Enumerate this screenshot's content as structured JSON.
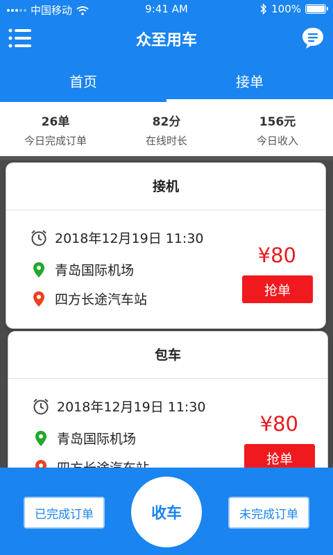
{
  "status_bar": {
    "carrier": "中国移动",
    "time": "9:41 AM",
    "battery": "100%"
  },
  "titlebar": {
    "title": "众至用车"
  },
  "tabs": [
    {
      "label": "首页",
      "active": false
    },
    {
      "label": "接单",
      "active": true
    }
  ],
  "stats": [
    {
      "value": "26单",
      "label": "今日完成订单"
    },
    {
      "value": "82分",
      "label": "在线时长"
    },
    {
      "value": "156元",
      "label": "今日收入"
    }
  ],
  "orders": [
    {
      "type": "接机",
      "time": "2018年12月19日  11:30",
      "from": "青岛国际机场",
      "to": "四方长途汽车站",
      "price": "¥80",
      "action": "抢单"
    },
    {
      "type": "包车",
      "time": "2018年12月19日  11:30",
      "from": "青岛国际机场",
      "to": "四方长途汽车站",
      "price": "¥80",
      "action": "抢单"
    }
  ],
  "bottom": {
    "done_label": "已完成订单",
    "finish_label": "收车",
    "undone_label": "未完成订单"
  },
  "colors": {
    "primary": "#1a84f0",
    "price": "#e8191e",
    "grab": "#f01a1e",
    "from_pin": "#22a82b",
    "to_pin": "#f0401e"
  }
}
